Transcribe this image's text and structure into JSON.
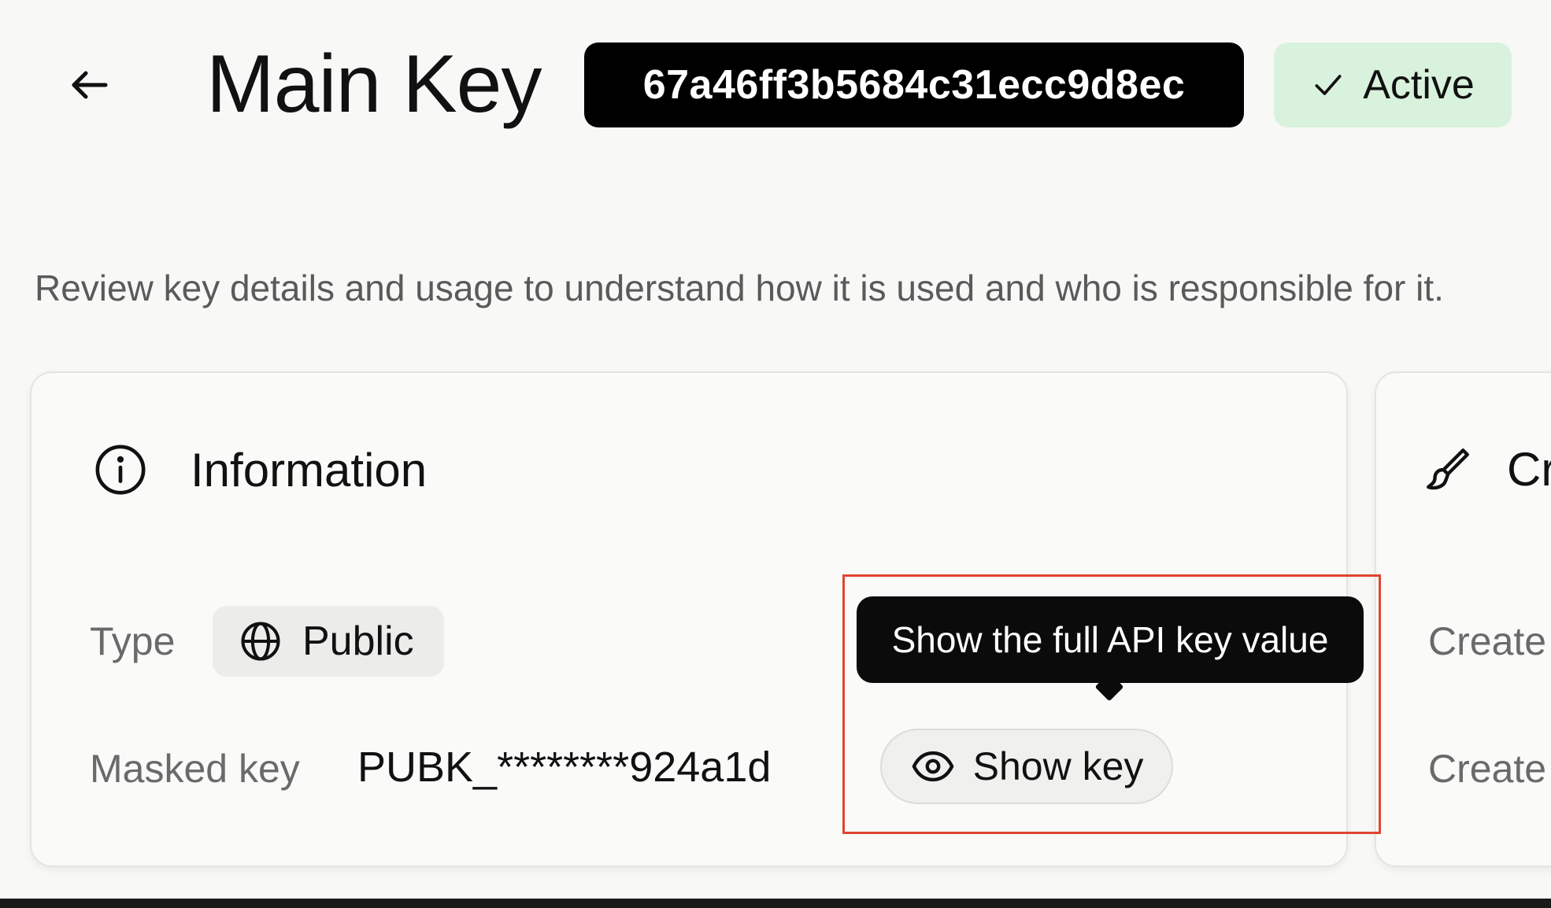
{
  "header": {
    "back_icon": "arrow-left-icon",
    "title": "Main Key",
    "key_id": "67a46ff3b5684c31ecc9d8ec",
    "status": {
      "label": "Active",
      "icon": "check-icon",
      "color": "#d9f2dd"
    }
  },
  "description": "Review key details and usage to understand how it is used and who is responsible for it.",
  "information_card": {
    "icon": "info-icon",
    "title": "Information",
    "type_label": "Type",
    "type_value": "Public",
    "type_icon": "globe-icon",
    "masked_key_label": "Masked key",
    "masked_key_value": "PUBK_********924a1d",
    "show_key_button": {
      "label": "Show key",
      "icon": "eye-icon"
    },
    "tooltip": "Show the full API key value"
  },
  "creator_card": {
    "icon": "brush-icon",
    "title_partial": "Cr",
    "rows": [
      "Create",
      "Create"
    ]
  },
  "colors": {
    "highlight": "#e0452f",
    "background": "#f8f8f7"
  }
}
